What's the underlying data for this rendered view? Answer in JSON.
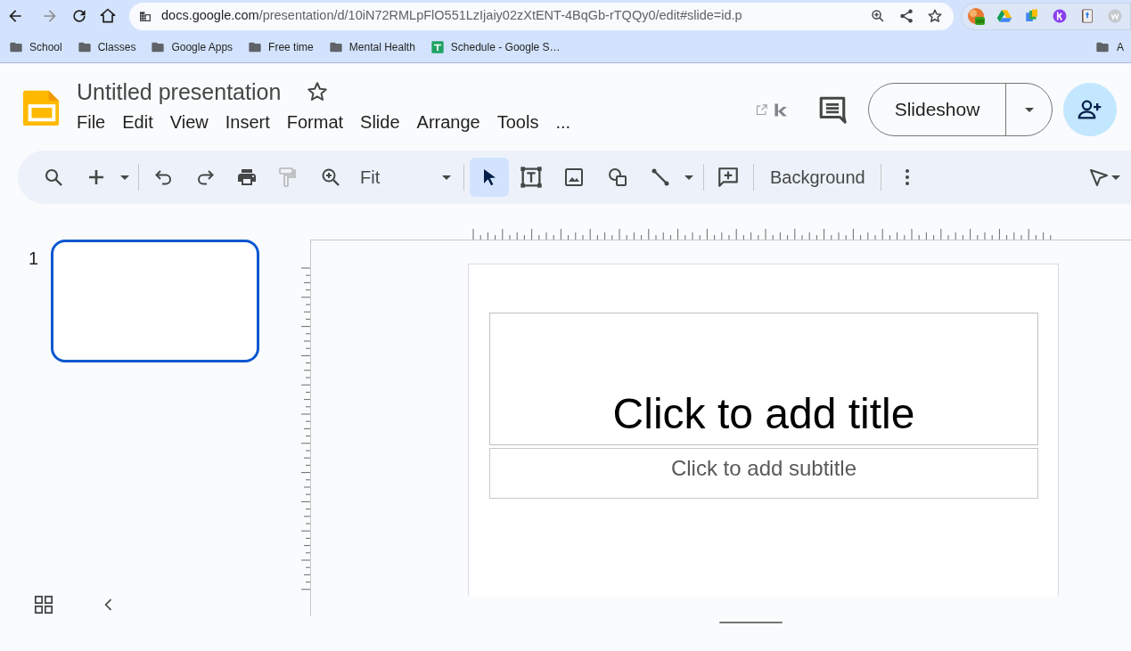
{
  "browser": {
    "url_host": "docs.google.com",
    "url_path": "/presentation/d/10iN72RMLpFlO551LzIjaiy02zXtENT-4BqGb-rTQQy0/edit#slide=id.p",
    "extension_badge": "on"
  },
  "bookmarks": [
    {
      "kind": "folder",
      "label": "School"
    },
    {
      "kind": "folder",
      "label": "Classes"
    },
    {
      "kind": "folder",
      "label": "Google Apps"
    },
    {
      "kind": "folder",
      "label": "Free time"
    },
    {
      "kind": "folder",
      "label": "Mental Health"
    },
    {
      "kind": "sheet",
      "label": "Schedule - Google S…"
    }
  ],
  "other_bookmarks": {
    "label": "A"
  },
  "document": {
    "title": "Untitled presentation",
    "starred": false
  },
  "menu": [
    "File",
    "Edit",
    "View",
    "Insert",
    "Format",
    "Slide",
    "Arrange",
    "Tools",
    "..."
  ],
  "slideshow_button": "Slideshow",
  "toolbar": {
    "zoom": "Fit",
    "background": "Background",
    "select_tool": {
      "selected": true
    },
    "paint_format": {
      "disabled": true
    }
  },
  "filmstrip": {
    "slides": [
      {
        "number": "1",
        "selected": true
      }
    ]
  },
  "slide": {
    "title_placeholder": "Click to add title",
    "subtitle_placeholder": "Click to add subtitle"
  }
}
